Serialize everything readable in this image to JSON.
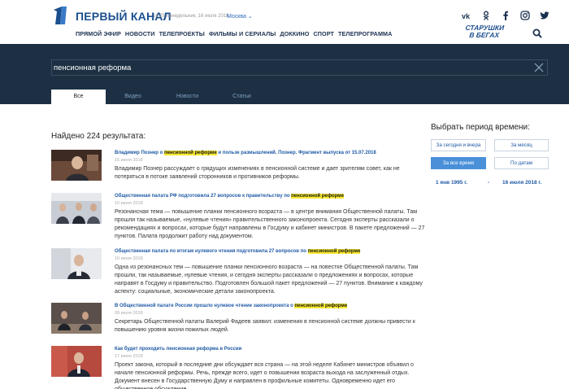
{
  "header": {
    "brand": "ПЕРВЫЙ КАНАЛ",
    "dateline": "16:25 понедельник, 16 июля 2018",
    "city": "Москва ⌄",
    "nav": [
      "ПРЯМОЙ ЭФИР",
      "НОВОСТИ",
      "ТЕЛЕПРОЕКТЫ",
      "ФИЛЬМЫ И СЕРИАЛЫ",
      "ДОККИНО",
      "СПОРТ",
      "ТЕЛЕПРОГРАММА"
    ],
    "promo_line1": "СТАРУШКИ",
    "promo_line2": "В БЕГАХ",
    "social_icons": [
      "vk-icon",
      "odnoklassniki-icon",
      "facebook-icon",
      "instagram-icon",
      "twitter-icon"
    ]
  },
  "search": {
    "query": "пенсионная реформа",
    "tabs": [
      "Все",
      "Видео",
      "Новости",
      "Статьи"
    ],
    "active_tab": 0
  },
  "results": {
    "found_label": "Найдено 224 результата:",
    "items": [
      {
        "title_before": "Владимир Познер о ",
        "title_hl": "пенсионной реформе",
        "title_after": " и пользе размышлений. Познер. Фрагмент выпуска от 15.07.2018",
        "date": "15 июля 2018",
        "desc": "Владимир Познер рассуждает о грядущих изменениях в пенсионной системе и дает зрителям совет, как не потеряться в потоке заявлений сторонников и противников реформы."
      },
      {
        "title_before": "Общественная палата РФ подготовила 27 вопросов к правительству по ",
        "title_hl": "пенсионной реформе",
        "title_after": "",
        "date": "10 июля 2018",
        "desc": "Резонансная тема — повышение планки пенсионного возраста — в центре внимания Общественной палаты. Там прошли так называемые, «нулевые чтения» правительственного законопроекта. Сегодня эксперты рассказали о рекомендациях и вопросах, которые будут направлены в Госдуму и кабинет министров. В пакете предложений — 27 пунктов. Палата продолжит работу над документом."
      },
      {
        "title_before": "Общественная палата по итогам нулевого чтения подготовила 27 вопросов по ",
        "title_hl": "пенсионной реформе",
        "title_after": "",
        "date": "10 июля 2018",
        "desc": "Одна из резонансных тем — повышение планки пенсионного возраста — на повестке Общественной палаты. Там прошли, так называемые, нулевые чтения, и сегодня эксперты рассказали о предложениях и вопросах, которые направят в Госдуму и правительство. Подготовлен большой пакет предложений — 27 пунктов. Внимание к каждому аспекту: социальные, экономические детали законопроекта."
      },
      {
        "title_before": "В Общественной палате России прошло нулевое чтение законопроекта о ",
        "title_hl": "пенсионной реформе",
        "title_after": "",
        "date": "09 июля 2018",
        "desc": "Секретарь Общественной палаты Валерий Фадеев заявил: изменения в пенсионной системе должны привести к повышению уровня жизни пожилых людей."
      },
      {
        "title_before": "Как будет проходить пенсионная реформа в России",
        "title_hl": "",
        "title_after": "",
        "date": "17 июня 2018",
        "desc": "Проект закона, который в последние дни обсуждает вся страна — на этой неделе Кабинет министров объявил о начале пенсионной реформы. Речь, прежде всего, идет о повышении возраста выхода на заслуженный отдых. Документ внесен в Государственную Думу и направлен в профильные комитеты. Одновременно идет его общественное обсуждение."
      }
    ]
  },
  "sidebar": {
    "title": "Выбрать период времени:",
    "btn_today": "За сегодня и вчера",
    "btn_month": "За месяц",
    "btn_all": "За все время",
    "btn_dates": "По датам",
    "date_from": "1 янв 1995 г.",
    "date_sep": "-",
    "date_to": "16 июля 2018 г."
  },
  "colors": {
    "brand_blue": "#1b4f8e",
    "band_bg": "#1d3043",
    "link_blue": "#1f5aa6",
    "highlight": "#f7e930",
    "active_button": "#4a90d9"
  }
}
